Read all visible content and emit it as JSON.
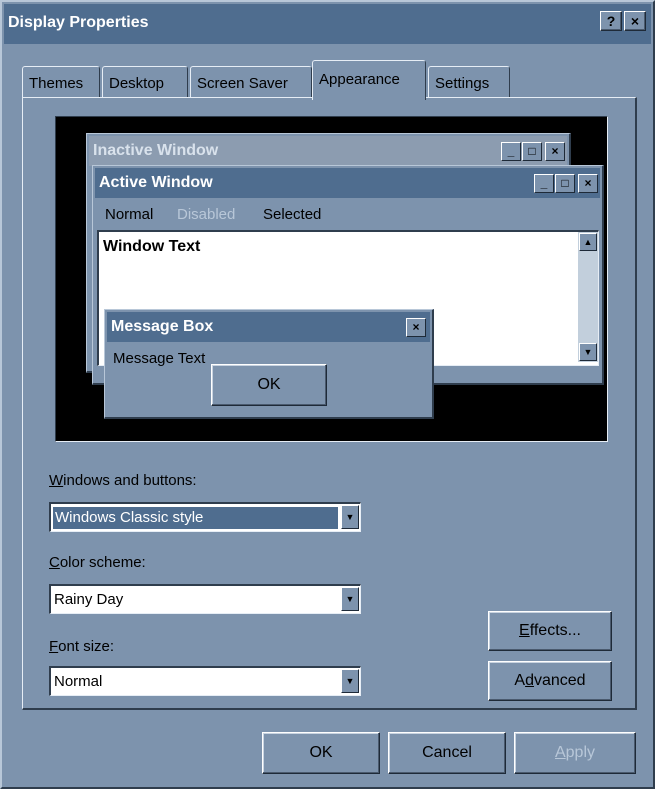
{
  "window": {
    "title": "Display Properties",
    "help_label": "?",
    "close_label": "×"
  },
  "tabs": [
    {
      "label": "Themes"
    },
    {
      "label": "Desktop"
    },
    {
      "label": "Screen Saver"
    },
    {
      "label": "Appearance"
    },
    {
      "label": "Settings"
    }
  ],
  "active_tab": "Appearance",
  "preview": {
    "inactive_title": "Inactive Window",
    "active_title": "Active Window",
    "menu": {
      "normal": "Normal",
      "disabled": "Disabled",
      "selected": "Selected"
    },
    "window_text": "Window Text",
    "message_box_title": "Message Box",
    "message_text": "Message Text",
    "ok_label": "OK"
  },
  "windows_and_buttons": {
    "label_accel": "W",
    "label_rest": "indows and buttons:",
    "value": "Windows Classic style"
  },
  "color_scheme": {
    "label_accel": "C",
    "label_rest": "olor scheme:",
    "value": "Rainy Day"
  },
  "font_size": {
    "label_accel": "F",
    "label_rest": "ont size:",
    "value": "Normal"
  },
  "effects_button": {
    "accel": "E",
    "rest": "ffects..."
  },
  "advanced_button": {
    "pre": "A",
    "accel": "d",
    "rest": "vanced"
  },
  "footer": {
    "ok": "OK",
    "cancel": "Cancel",
    "apply_accel": "A",
    "apply_rest": "pply"
  },
  "colors": {
    "face": "#7d93ad",
    "titlebar": "#4f6d8f",
    "inactive_titlebar": "#8c9cb0",
    "disabled_text": "#b8c7d8"
  }
}
